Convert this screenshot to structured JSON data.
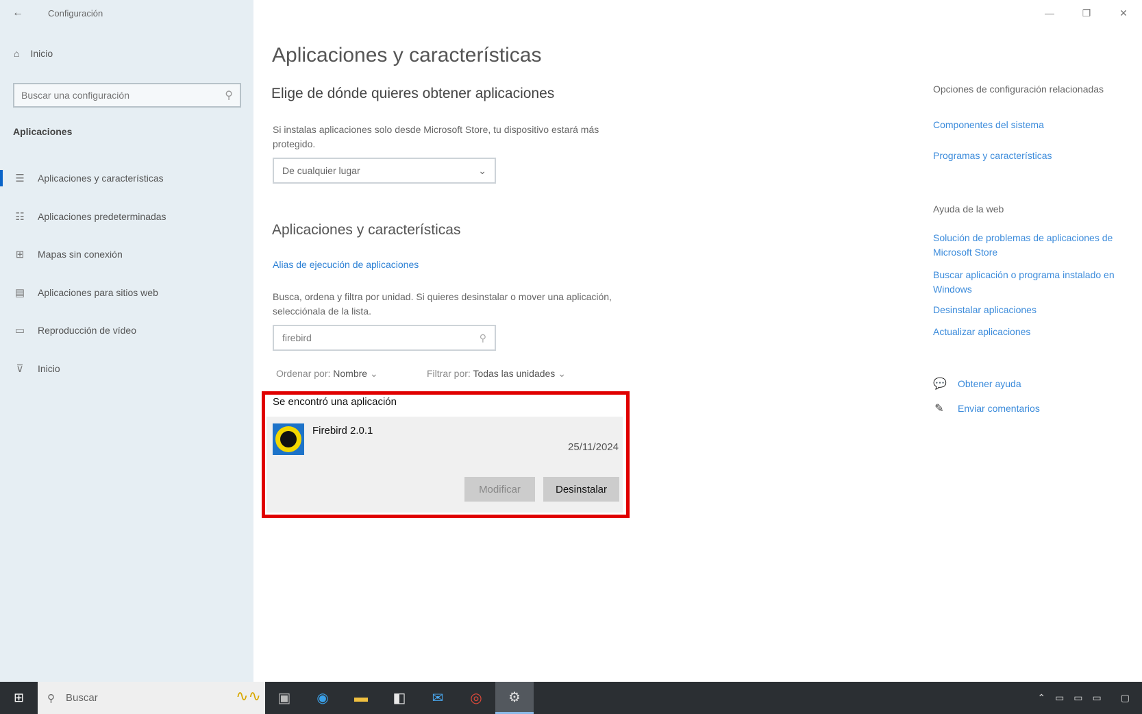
{
  "window": {
    "title": "Configuración",
    "back_icon": "←",
    "minimize": "—",
    "maximize": "❐",
    "close": "✕"
  },
  "sidebar": {
    "home": {
      "icon": "⌂",
      "label": "Inicio"
    },
    "search_placeholder": "Buscar una configuración",
    "search_icon": "⚲",
    "section": "Aplicaciones",
    "items": [
      {
        "icon": "☰",
        "label": "Aplicaciones y características",
        "active": true
      },
      {
        "icon": "☷",
        "label": "Aplicaciones predeterminadas",
        "active": false
      },
      {
        "icon": "⊞",
        "label": "Mapas sin conexión",
        "active": false
      },
      {
        "icon": "▤",
        "label": "Aplicaciones para sitios web",
        "active": false
      },
      {
        "icon": "▭",
        "label": "Reproducción de vídeo",
        "active": false
      },
      {
        "icon": "⊽",
        "label": "Inicio",
        "active": false
      }
    ]
  },
  "main": {
    "title": "Aplicaciones y características",
    "source_heading": "Elige de dónde quieres obtener aplicaciones",
    "source_desc": "Si instalas aplicaciones solo desde Microsoft Store, tu dispositivo estará más protegido.",
    "source_dropdown": "De cualquier lugar",
    "apps_heading": "Aplicaciones y características",
    "alias_link": "Alias de ejecución de aplicaciones",
    "filter_desc": "Busca, ordena y filtra por unidad. Si quieres desinstalar o mover una aplicación, selecciónala de la lista.",
    "filter_value": "firebird",
    "sort_label": "Ordenar por:",
    "sort_value": "Nombre",
    "filter_label": "Filtrar por:",
    "filter_drive": "Todas las unidades",
    "results_count": "Se encontró una aplicación",
    "app": {
      "name": "Firebird 2.0.1",
      "date": "25/11/2024",
      "modify_label": "Modificar",
      "uninstall_label": "Desinstalar"
    }
  },
  "right": {
    "related_heading": "Opciones de configuración relacionadas",
    "related_links": [
      "Componentes del sistema",
      "Programas y características"
    ],
    "web_heading": "Ayuda de la web",
    "web_links": [
      "Solución de problemas de aplicaciones de Microsoft Store",
      "Buscar aplicación o programa instalado en Windows",
      "Desinstalar aplicaciones",
      "Actualizar aplicaciones"
    ],
    "get_help": "Obtener ayuda",
    "feedback": "Enviar comentarios"
  },
  "taskbar": {
    "search_placeholder": "Buscar"
  }
}
